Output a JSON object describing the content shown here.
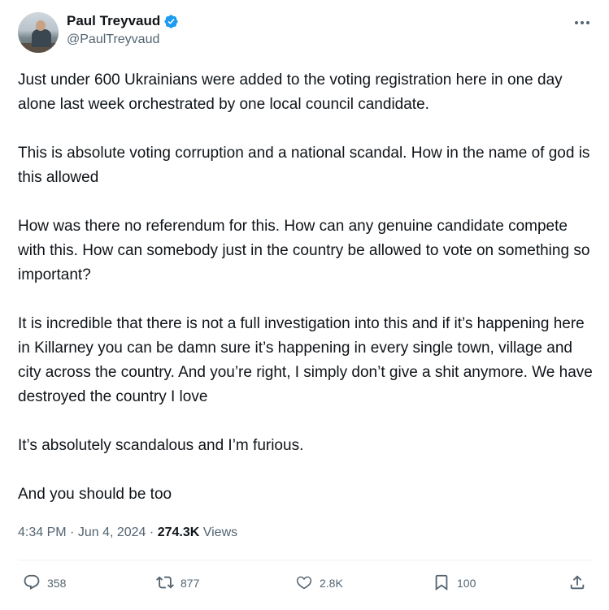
{
  "author": {
    "display_name": "Paul Treyvaud",
    "handle": "@PaulTreyvaud",
    "verified": true,
    "verified_color": "#1d9bf0"
  },
  "icons": {
    "more": "more-horizontal-icon",
    "reply": "reply-bubble-icon",
    "repost": "repost-arrows-icon",
    "like": "heart-icon",
    "bookmark": "bookmark-icon",
    "share": "share-upload-icon"
  },
  "tweet": {
    "paragraphs": [
      "Just under 600 Ukrainians were added to the voting registration here in one day alone last week orchestrated by one local council candidate.",
      "This is absolute voting corruption and a national scandal. How in the name of god is this allowed",
      "How was there no referendum for this. How can any genuine candidate compete with this. How can somebody just in the country be allowed to vote on something so important?",
      "It is incredible that there is not a full investigation into this and if it’s happening here in Killarney you can be damn sure it’s happening in every single town, village and city across the country. And you’re right, I simply don’t give a shit anymore. We have destroyed the country I love",
      "It’s absolutely scandalous and I’m furious.",
      "And you should be too"
    ]
  },
  "meta": {
    "time": "4:34 PM",
    "separator": "·",
    "date": "Jun 4, 2024",
    "views_count": "274.3K",
    "views_label": "Views"
  },
  "actions": {
    "replies": "358",
    "reposts": "877",
    "likes": "2.8K",
    "bookmarks": "100"
  },
  "colors": {
    "text": "#0f1419",
    "secondary": "#536471",
    "divider": "#eff3f4"
  }
}
